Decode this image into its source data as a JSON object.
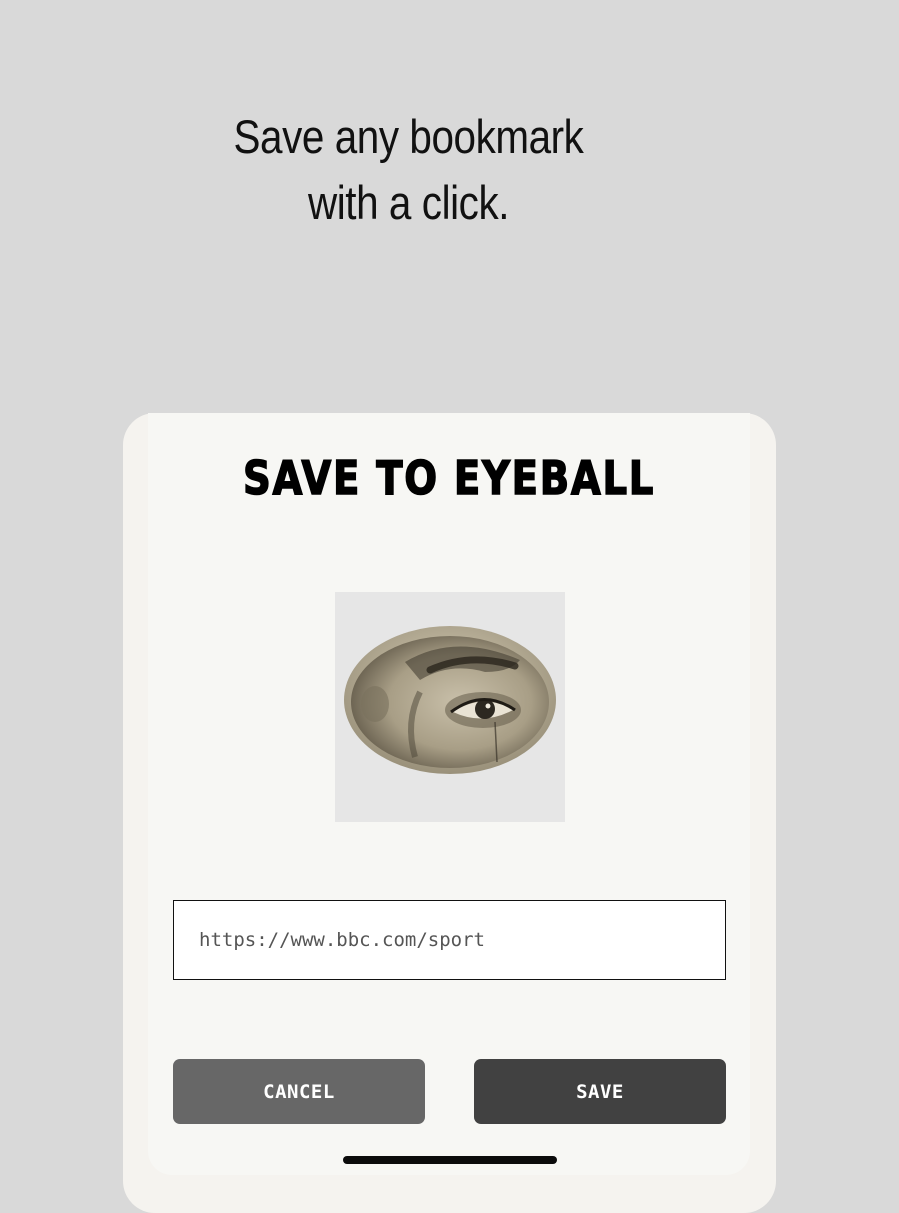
{
  "promo": {
    "line1": "Save any bookmark",
    "line2": "with a click."
  },
  "dialog": {
    "title": "SAVE TO EYEBALL",
    "preview_image": "eye-illustration",
    "url_value": "https://www.bbc.com/sport",
    "cancel_label": "CANCEL",
    "save_label": "SAVE"
  },
  "colors": {
    "page_bg": "#d9d9d9",
    "sheet_bg": "#f7f7f4",
    "cancel_bg": "#676767",
    "save_bg": "#414141"
  }
}
